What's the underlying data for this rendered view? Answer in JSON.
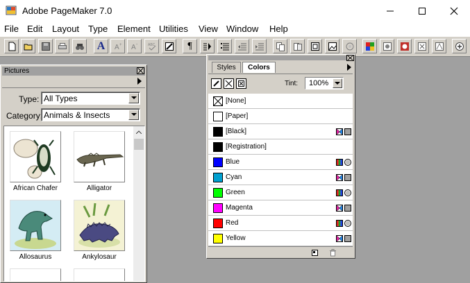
{
  "window": {
    "title": "Adobe PageMaker 7.0"
  },
  "menu": [
    "File",
    "Edit",
    "Layout",
    "Type",
    "Element",
    "Utilities",
    "View",
    "Window",
    "Help"
  ],
  "pictures_panel": {
    "title": "Pictures",
    "type_label": "Type:",
    "type_value": "All Types",
    "category_label": "Category:",
    "category_value": "Animals & Insects",
    "items": [
      {
        "label": "African Chafer"
      },
      {
        "label": "Alligator"
      },
      {
        "label": "Allosaurus"
      },
      {
        "label": "Ankylosaur"
      }
    ]
  },
  "colors_panel": {
    "tabs": [
      "Styles",
      "Colors"
    ],
    "active_tab": "Colors",
    "tint_label": "Tint:",
    "tint_value": "100%",
    "colors": [
      {
        "name": "[None]",
        "swatch": "none"
      },
      {
        "name": "[Paper]",
        "swatch": "#ffffff"
      },
      {
        "name": "[Black]",
        "swatch": "#000000"
      },
      {
        "name": "[Registration]",
        "swatch": "#000000"
      },
      {
        "name": "Blue",
        "swatch": "#0000ff"
      },
      {
        "name": "Cyan",
        "swatch": "#00a0d0"
      },
      {
        "name": "Green",
        "swatch": "#00ff00"
      },
      {
        "name": "Magenta",
        "swatch": "#ff00ff"
      },
      {
        "name": "Red",
        "swatch": "#ff0000"
      },
      {
        "name": "Yellow",
        "swatch": "#ffff00"
      }
    ]
  },
  "toolbar_text_glyphs": {
    "char_a": "A",
    "pilcrow": "¶"
  }
}
